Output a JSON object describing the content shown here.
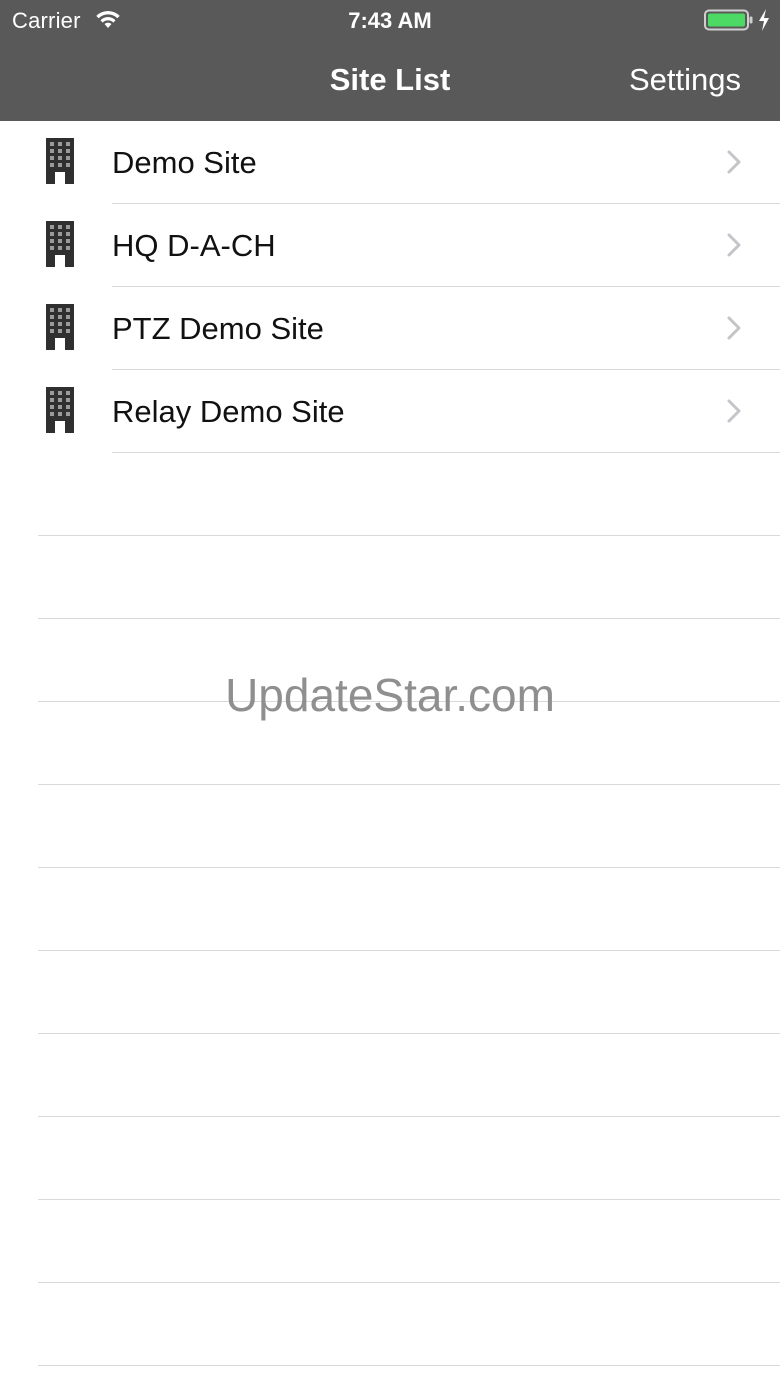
{
  "status_bar": {
    "carrier": "Carrier",
    "time": "7:43 AM",
    "wifi_icon": "wifi-icon",
    "battery_icon": "battery-charging-icon",
    "battery_color": "#4cd964"
  },
  "nav": {
    "title": "Site List",
    "settings_label": "Settings",
    "bar_color": "#595959"
  },
  "sites": [
    {
      "label": "Demo Site",
      "icon": "building-icon"
    },
    {
      "label": "HQ D-A-CH",
      "icon": "building-icon"
    },
    {
      "label": "PTZ Demo Site",
      "icon": "building-icon"
    },
    {
      "label": "Relay Demo Site",
      "icon": "building-icon"
    }
  ],
  "watermark": "UpdateStar.com"
}
